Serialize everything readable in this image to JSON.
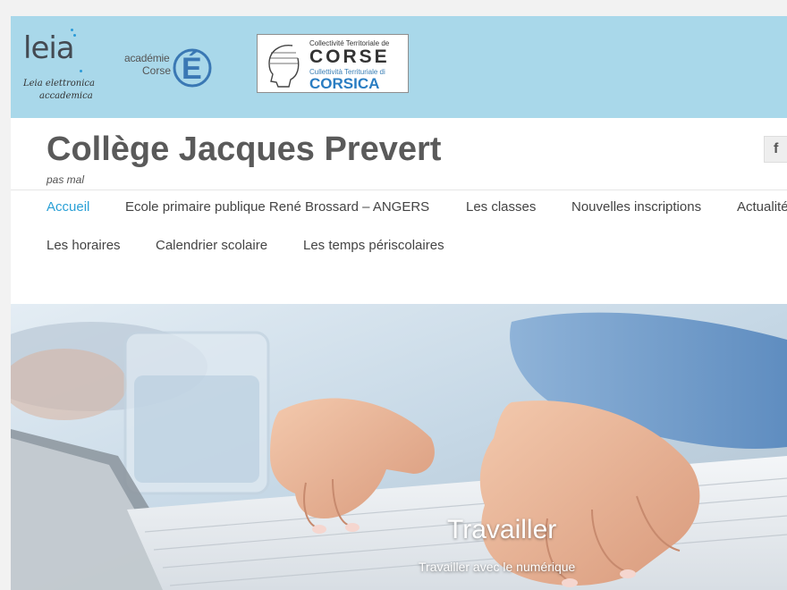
{
  "banner": {
    "leia": {
      "word": "leia",
      "line1": "Leia elettronica",
      "line2": "accademica"
    },
    "academie": {
      "line1": "académie",
      "line2": "Corse",
      "letter": "É"
    },
    "ctc": {
      "line1": "Collectivité Territoriale de",
      "line2": "CORSE",
      "line3": "Cullettività Territuriale di",
      "line4": "CORSICA"
    },
    "colors": {
      "background": "#a9d8ea",
      "brand_blue": "#2a7dc2"
    }
  },
  "header": {
    "title": "Collège Jacques Prevert",
    "tagline": "pas mal",
    "social": {
      "facebook_label": "f",
      "icon": "facebook-icon"
    }
  },
  "nav": {
    "accent_color": "#2aa0d6",
    "items": [
      {
        "label": "Accueil",
        "active": true
      },
      {
        "label": "Ecole primaire publique René Brossard – ANGERS"
      },
      {
        "label": "Les classes"
      },
      {
        "label": "Nouvelles inscriptions"
      },
      {
        "label": "Actualité"
      },
      {
        "label": "Les horaires"
      },
      {
        "label": "Calendrier scolaire"
      },
      {
        "label": "Les temps périscolaires"
      }
    ]
  },
  "hero": {
    "title": "Travailler",
    "subtitle": "Travailler avec le numérique",
    "image": "hands-typing-on-keyboard-photo"
  }
}
